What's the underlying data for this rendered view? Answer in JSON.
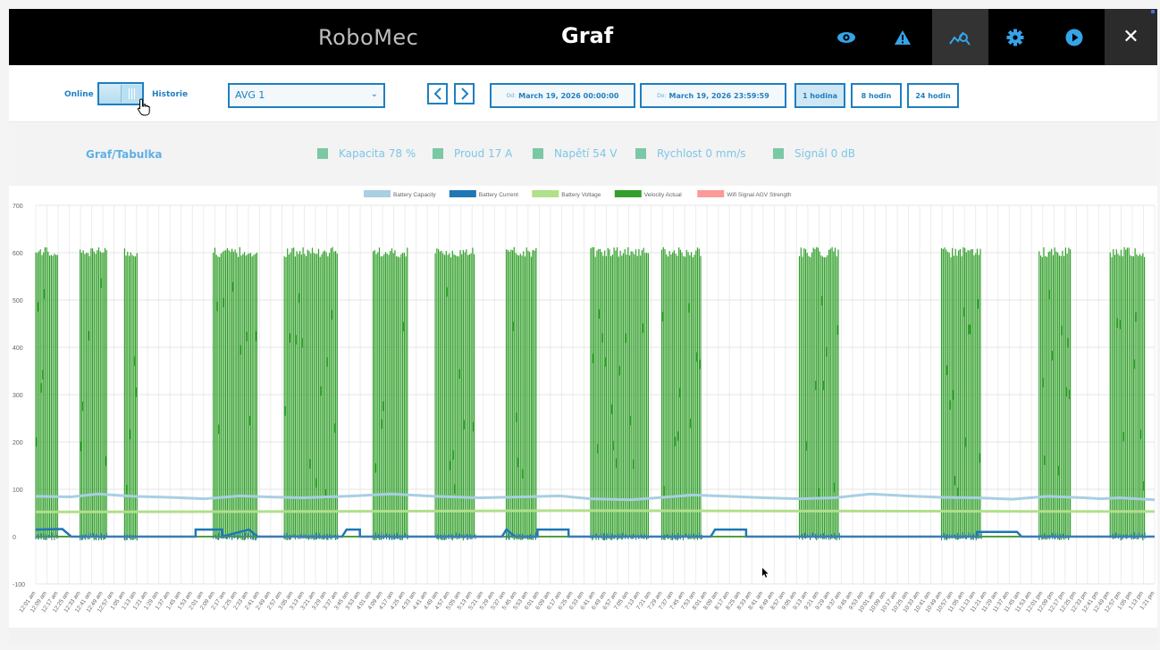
{
  "header": {
    "brand": "RoboMec",
    "title": "Graf",
    "icons": [
      "eye-icon",
      "warning-icon",
      "chart-search-icon",
      "gear-icon",
      "play-icon"
    ],
    "close": "✕"
  },
  "toolbar": {
    "online_label": "Online",
    "history_label": "Historie",
    "agv_select": "AVG 1",
    "from_label": "Od:",
    "from_value": "March 19, 2026 00:00:00",
    "to_label": "Do:",
    "to_value": "March 19, 2026 23:59:59",
    "ranges": [
      "1 hodina",
      "8 hodin",
      "24 hodin"
    ],
    "active_range": "1 hodina"
  },
  "infobar": {
    "tab_label": "Graf/Tabulka",
    "metrics": [
      "Kapacita 78 %",
      "Proud 17 A",
      "Napětí 54 V",
      "Rychlost 0 mm/s",
      "Signál 0 dB"
    ]
  },
  "colors": {
    "accent": "#1f7fc0",
    "battery_capacity": "#a8cfe2",
    "battery_current": "#1f77b4",
    "battery_voltage": "#b2df8a",
    "velocity_actual": "#33a02c",
    "wifi_signal": "#fb9a99"
  },
  "chart_data": {
    "type": "line",
    "legend": [
      "Battery Capacity",
      "Battery Current",
      "Battery Voltage",
      "Velocity Actual",
      "Wifi Signal AGV Strength"
    ],
    "legend_position": "top",
    "ylim": [
      -100,
      700
    ],
    "yticks": [
      "700",
      "600",
      "500",
      "400",
      "300",
      "200",
      "100",
      "0",
      "-100"
    ],
    "grid": true,
    "xticks": [
      "12:01 am",
      "12:09 am",
      "12:17 am",
      "12:25 am",
      "12:33 am",
      "12:41 am",
      "12:49 am",
      "12:57 am",
      "1:05 am",
      "1:13 am",
      "1:21 am",
      "1:29 am",
      "1:37 am",
      "1:45 am",
      "1:53 am",
      "2:01 am",
      "2:09 am",
      "2:17 am",
      "2:25 am",
      "2:33 am",
      "2:41 am",
      "2:49 am",
      "2:57 am",
      "3:05 am",
      "3:13 am",
      "3:21 am",
      "3:29 am",
      "3:37 am",
      "3:45 am",
      "3:53 am",
      "4:01 am",
      "4:09 am",
      "4:17 am",
      "4:25 am",
      "4:33 am",
      "4:41 am",
      "4:49 am",
      "4:57 am",
      "5:05 am",
      "5:13 am",
      "5:21 am",
      "5:29 am",
      "5:37 am",
      "5:45 am",
      "5:53 am",
      "6:01 am",
      "6:09 am",
      "6:17 am",
      "6:25 am",
      "6:33 am",
      "6:41 am",
      "6:49 am",
      "6:57 am",
      "7:05 am",
      "7:13 am",
      "7:21 am",
      "7:29 am",
      "7:37 am",
      "7:45 am",
      "7:53 am",
      "8:01 am",
      "8:09 am",
      "8:17 am",
      "8:25 am",
      "8:33 am",
      "8:41 am",
      "8:49 am",
      "8:57 am",
      "9:05 am",
      "9:13 am",
      "9:21 am",
      "9:29 am",
      "9:37 am",
      "9:45 am",
      "9:53 am",
      "10:01 am",
      "10:09 am",
      "10:17 am",
      "10:25 am",
      "10:33 am",
      "10:41 am",
      "10:49 am",
      "10:57 am",
      "11:05 am",
      "11:13 am",
      "11:21 am",
      "11:29 am",
      "11:37 am",
      "11:45 am",
      "11:53 am",
      "12:01 pm",
      "12:09 pm",
      "12:17 pm",
      "12:25 pm",
      "12:33 pm",
      "12:41 pm",
      "12:49 pm",
      "12:57 pm",
      "1:05 pm",
      "1:13 pm",
      "1:21 pm"
    ],
    "series": [
      {
        "name": "Battery Capacity",
        "points": [
          [
            0,
            85
          ],
          [
            8,
            84
          ],
          [
            14,
            90
          ],
          [
            22,
            85
          ],
          [
            30,
            83
          ],
          [
            38,
            80
          ],
          [
            46,
            86
          ],
          [
            52,
            84
          ],
          [
            60,
            82
          ],
          [
            72,
            86
          ],
          [
            80,
            90
          ],
          [
            90,
            85
          ],
          [
            100,
            82
          ],
          [
            110,
            84
          ],
          [
            118,
            86
          ],
          [
            125,
            80
          ],
          [
            134,
            78
          ],
          [
            140,
            82
          ],
          [
            148,
            88
          ],
          [
            156,
            85
          ],
          [
            164,
            82
          ],
          [
            172,
            80
          ],
          [
            180,
            82
          ],
          [
            188,
            90
          ],
          [
            196,
            86
          ],
          [
            204,
            83
          ],
          [
            212,
            82
          ],
          [
            220,
            79
          ],
          [
            228,
            85
          ],
          [
            236,
            82
          ],
          [
            240,
            80
          ],
          [
            244,
            82
          ],
          [
            252,
            78
          ]
        ]
      },
      {
        "name": "Battery Voltage",
        "points": [
          [
            0,
            52
          ],
          [
            60,
            53
          ],
          [
            120,
            55
          ],
          [
            180,
            54
          ],
          [
            252,
            53
          ]
        ]
      },
      {
        "name": "Battery Current",
        "steps": [
          [
            0,
            15
          ],
          [
            6,
            16
          ],
          [
            8,
            0
          ],
          [
            36,
            0
          ],
          [
            36,
            15
          ],
          [
            42,
            15
          ],
          [
            42,
            0
          ],
          [
            48,
            15
          ],
          [
            50,
            0
          ],
          [
            69,
            0
          ],
          [
            70,
            15
          ],
          [
            73,
            15
          ],
          [
            73,
            0
          ],
          [
            105,
            0
          ],
          [
            106,
            15
          ],
          [
            108,
            0
          ],
          [
            113,
            0
          ],
          [
            113,
            15
          ],
          [
            120,
            15
          ],
          [
            120,
            0
          ],
          [
            152,
            0
          ],
          [
            153,
            15
          ],
          [
            160,
            15
          ],
          [
            160,
            0
          ],
          [
            212,
            0
          ],
          [
            212,
            10
          ],
          [
            221,
            10
          ],
          [
            222,
            0
          ],
          [
            252,
            0
          ]
        ]
      },
      {
        "name": "Velocity Actual",
        "bursts": [
          [
            0,
            5
          ],
          [
            10,
            16
          ],
          [
            20,
            23
          ],
          [
            40,
            50
          ],
          [
            56,
            68
          ],
          [
            76,
            84
          ],
          [
            90,
            99
          ],
          [
            106,
            112
          ],
          [
            112,
            113
          ],
          [
            125,
            138
          ],
          [
            141,
            150
          ],
          [
            172,
            181
          ],
          [
            204,
            213
          ],
          [
            226,
            233
          ],
          [
            242,
            250
          ]
        ]
      },
      {
        "name": "Wifi Signal AGV Strength",
        "points": [
          [
            0,
            0
          ],
          [
            252,
            0
          ]
        ]
      }
    ]
  }
}
